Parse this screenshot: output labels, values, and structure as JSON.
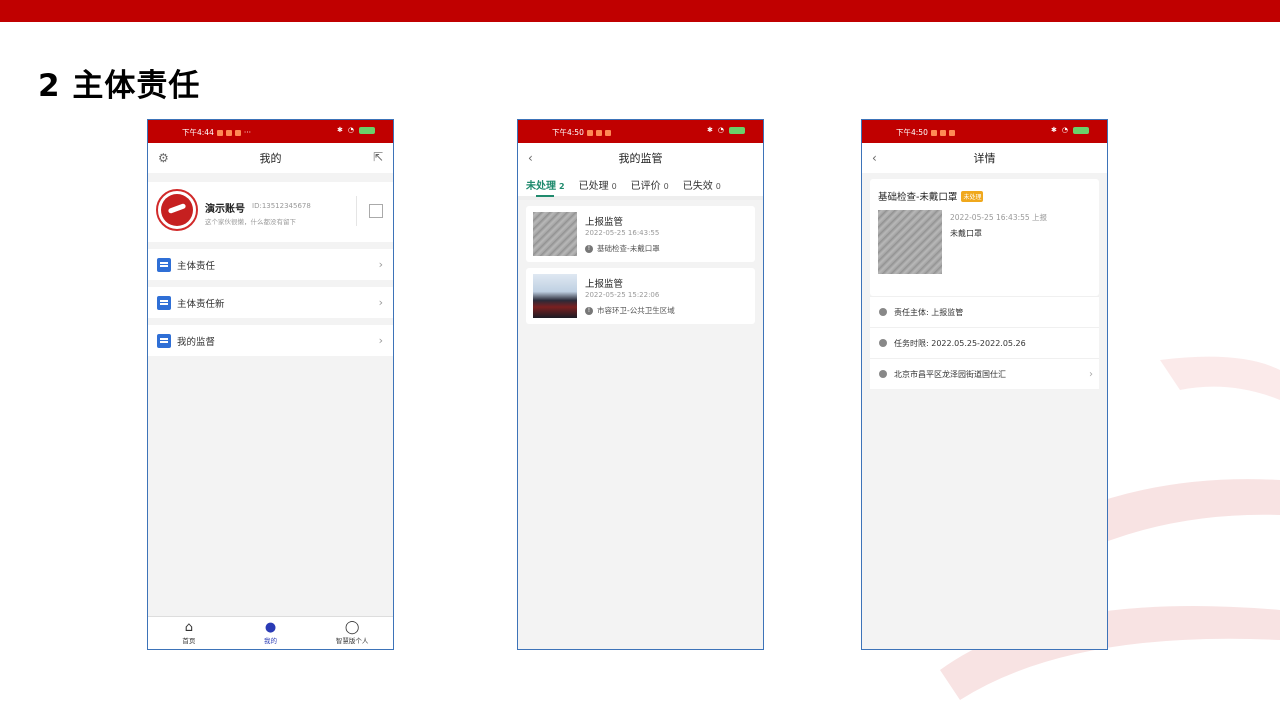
{
  "slide": {
    "title": "2 主体责任"
  },
  "colors": {
    "brand_red": "#c00000",
    "active_green": "#1f8a6d",
    "tab_active_blue": "#2a3bb5",
    "badge_orange": "#f0a81c"
  },
  "phone1": {
    "status_time": "下午4:44",
    "status_more": "···",
    "nav_title": "我的",
    "settings_icon": "gear-icon",
    "share_icon": "share-icon",
    "profile": {
      "name": "演示账号",
      "id": "ID:13512345678",
      "desc": "这个家伙很懒，什么都没有留下"
    },
    "menu": [
      {
        "label": "主体责任",
        "icon": "document-icon"
      },
      {
        "label": "主体责任新",
        "icon": "document-icon"
      },
      {
        "label": "我的监督",
        "icon": "shield-icon"
      }
    ],
    "tabbar": [
      {
        "label": "首页",
        "icon": "home-icon"
      },
      {
        "label": "我的",
        "icon": "person-icon",
        "active": true
      },
      {
        "label": "智慧版个人",
        "icon": "avatar-icon"
      }
    ]
  },
  "phone2": {
    "status_time": "下午4:50",
    "status_more": "···",
    "nav_title": "我的监管",
    "tabs": [
      {
        "label": "未处理",
        "count": "2",
        "active": true
      },
      {
        "label": "已处理",
        "count": "0"
      },
      {
        "label": "已评价",
        "count": "0"
      },
      {
        "label": "已失效",
        "count": "0"
      }
    ],
    "cards": [
      {
        "title": "上报监管",
        "time": "2022-05-25 16:43:55",
        "tag": "基础检查-未戴口罩"
      },
      {
        "title": "上报监管",
        "time": "2022-05-25 15:22:06",
        "tag": "市容环卫-公共卫生区域"
      }
    ]
  },
  "phone3": {
    "status_time": "下午4:50",
    "status_more": "···",
    "nav_title": "详情",
    "detail": {
      "title": "基础检查-未戴口罩",
      "badge": "未处理",
      "time": "2022-05-25 16:43:55 上报",
      "text": "未戴口罩"
    },
    "rows": [
      {
        "label": "责任主体: 上报监管",
        "icon": "home-icon"
      },
      {
        "label": "任务时限: 2022.05.25-2022.05.26",
        "icon": "clock-icon"
      },
      {
        "label": "北京市昌平区龙泽园街道国仕汇",
        "icon": "location-icon"
      }
    ]
  }
}
